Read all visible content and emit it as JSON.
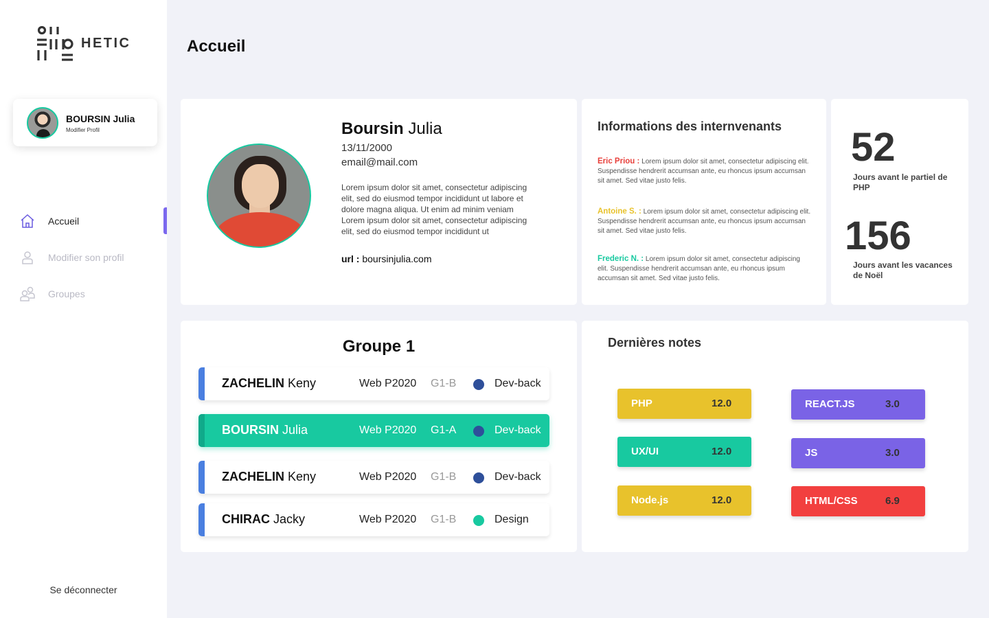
{
  "brand": {
    "name": "HETIC"
  },
  "user": {
    "last_name": "BOURSIN",
    "first_name": "Julia",
    "edit_label": "Modifier Profil"
  },
  "nav": {
    "items": [
      {
        "label": "Accueil",
        "icon": "home-icon",
        "active": true
      },
      {
        "label": "Modifier son profil",
        "icon": "user-icon",
        "active": false
      },
      {
        "label": "Groupes",
        "icon": "group-icon",
        "active": false
      }
    ],
    "logout_label": "Se déconnecter"
  },
  "page": {
    "title": "Accueil"
  },
  "profile": {
    "last_name": "Boursin",
    "first_name": "Julia",
    "dob": "13/11/2000",
    "email": "email@mail.com",
    "bio": "Lorem ipsum dolor sit amet, consectetur adipiscing elit, sed do eiusmod tempor incididunt ut labore et dolore magna aliqua. Ut enim ad minim veniam Lorem ipsum dolor sit amet, consectetur adipiscing elit, sed do eiusmod tempor incididunt ut",
    "url_label": "url :",
    "url": "boursinjulia.com"
  },
  "intervenants": {
    "title": "Informations des internvenants",
    "items": [
      {
        "name": "Eric Priou :",
        "color": "#e8413c",
        "text": "Lorem ipsum dolor sit amet, consectetur adipiscing elit. Suspendisse hendrerit accumsan ante, eu rhoncus ipsum accumsan sit amet. Sed vitae justo felis."
      },
      {
        "name": "Antoine S. :",
        "color": "#e8c22c",
        "text": "Lorem ipsum dolor sit amet, consectetur adipiscing elit. Suspendisse hendrerit accumsan ante, eu rhoncus ipsum accumsan sit amet. Sed vitae justo felis."
      },
      {
        "name": "Frederic N. :",
        "color": "#18c9a0",
        "text": "Lorem ipsum dolor sit amet, consectetur adipiscing elit. Suspendisse hendrerit accumsan ante, eu rhoncus ipsum accumsan sit amet. Sed vitae justo felis."
      }
    ]
  },
  "countdown": [
    {
      "value": "52",
      "label": "Jours avant le partiel de PHP"
    },
    {
      "value": "156",
      "label": "Jours avant les vacances de Noël"
    }
  ],
  "group": {
    "title": "Groupe 1",
    "members": [
      {
        "last": "ZACHELIN",
        "first": "Keny",
        "promo": "Web P2020",
        "sub": "G1-B",
        "dot": "#2e4f9a",
        "track": "Dev-back",
        "active": false
      },
      {
        "last": "BOURSIN",
        "first": "Julia",
        "promo": "Web P2020",
        "sub": "G1-A",
        "dot": "#2e4f9a",
        "track": "Dev-back",
        "active": true
      },
      {
        "last": "ZACHELIN",
        "first": "Keny",
        "promo": "Web P2020",
        "sub": "G1-B",
        "dot": "#2e4f9a",
        "track": "Dev-back",
        "active": false
      },
      {
        "last": "CHIRAC",
        "first": "Jacky",
        "promo": "Web P2020",
        "sub": "G1-B",
        "dot": "#18c9a0",
        "track": "Design",
        "active": false
      }
    ]
  },
  "notes": {
    "title": "Dernières notes",
    "items": [
      {
        "subject": "PHP",
        "score": "12.0",
        "color": "#e8c22c"
      },
      {
        "subject": "UX/UI",
        "score": "12.0",
        "color": "#18c9a0"
      },
      {
        "subject": "Node.js",
        "score": "12.0",
        "color": "#e8c22c"
      },
      {
        "subject": "REACT.JS",
        "score": "3.0",
        "color": "#7a63e6"
      },
      {
        "subject": "JS",
        "score": "3.0",
        "color": "#7a63e6"
      },
      {
        "subject": "HTML/CSS",
        "score": "6.9",
        "color": "#f2403f"
      }
    ]
  }
}
